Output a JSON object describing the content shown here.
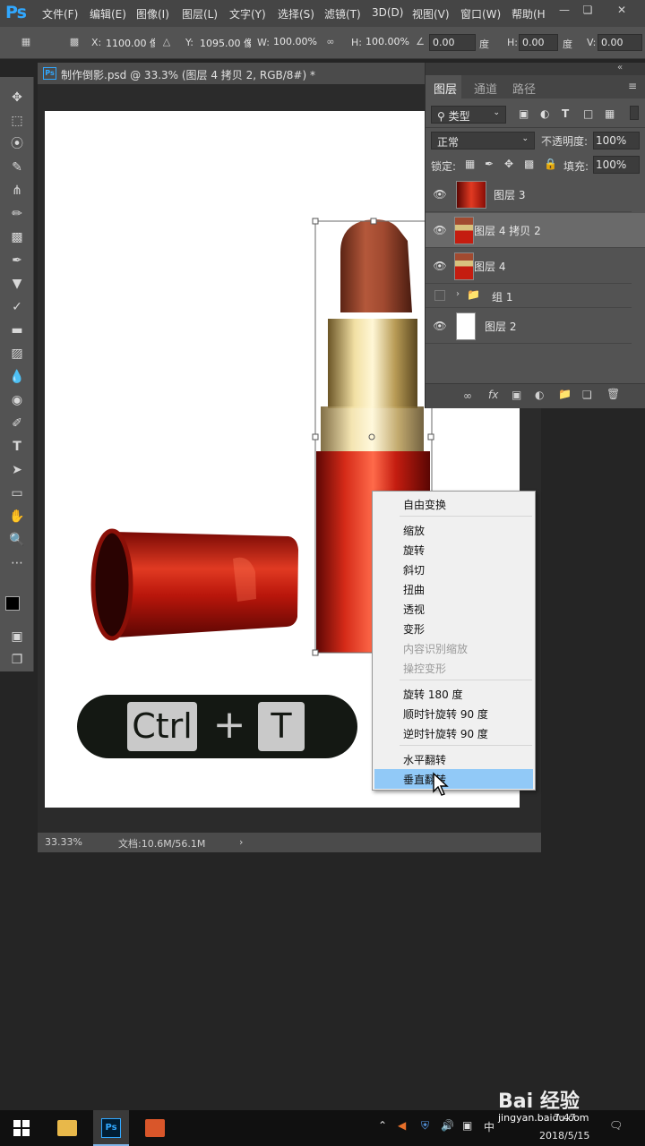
{
  "app": {
    "logo": "Ps"
  },
  "menu": [
    "文件(F)",
    "编辑(E)",
    "图像(I)",
    "图层(L)",
    "文字(Y)",
    "选择(S)",
    "滤镜(T)",
    "3D(D)",
    "视图(V)",
    "窗口(W)",
    "帮助(H"
  ],
  "options": {
    "x_label": "X:",
    "x_value": "1100.00 像",
    "y_label": "Y:",
    "y_value": "1095.00 像",
    "w_label": "W:",
    "w_value": "100.00%",
    "h_label": "H:",
    "h_value": "100.00%",
    "angle_value": "0.00",
    "angle_unit": "度",
    "hskew_label": "H:",
    "hskew_value": "0.00",
    "hskew_unit": "度",
    "vskew_label": "V:",
    "vskew_value": "0.00"
  },
  "document": {
    "tab_title": "制作倒影.psd @ 33.3% (图层 4 拷贝 2, RGB/8#) *",
    "zoom": "33.33%",
    "doc_size": "文档:10.6M/56.1M"
  },
  "shortcut": {
    "key1": "Ctrl",
    "plus": "+",
    "key2": "T"
  },
  "layers_panel": {
    "tabs": [
      "图层",
      "通道",
      "路径"
    ],
    "filter_kind": "类型",
    "blend_mode": "正常",
    "opacity_label": "不透明度:",
    "opacity_value": "100%",
    "lock_label": "锁定:",
    "fill_label": "填充:",
    "fill_value": "100%",
    "layers": [
      {
        "name": "图层 3",
        "visible": true,
        "thumb": "cap"
      },
      {
        "name": "图层 4 拷贝 2",
        "visible": true,
        "thumb": "lipstick",
        "selected": true
      },
      {
        "name": "图层 4",
        "visible": true,
        "thumb": "lipstick"
      },
      {
        "name": "组 1",
        "visible": false,
        "thumb": "folder"
      },
      {
        "name": "图层 2",
        "visible": true,
        "thumb": "white"
      }
    ]
  },
  "context_menu": {
    "items": [
      "自由变换",
      "缩放",
      "旋转",
      "斜切",
      "扭曲",
      "透视",
      "变形",
      "内容识别缩放",
      "操控变形",
      "旋转 180 度",
      "顺时针旋转 90 度",
      "逆时针旋转 90 度",
      "水平翻转",
      "垂直翻转"
    ]
  },
  "taskbar": {
    "ime": "中",
    "watermark_site": "jingyan.baidu.com",
    "watermark_brand": "Bai 经验",
    "time": "7:47",
    "date": "2018/5/15"
  },
  "colors": {
    "accent": "#31a8ff",
    "menu_highlight": "#91c9f7",
    "lipstick_red": "#b8130d",
    "lipstick_bullet": "#9a4a33",
    "gold": "#c8a963"
  }
}
